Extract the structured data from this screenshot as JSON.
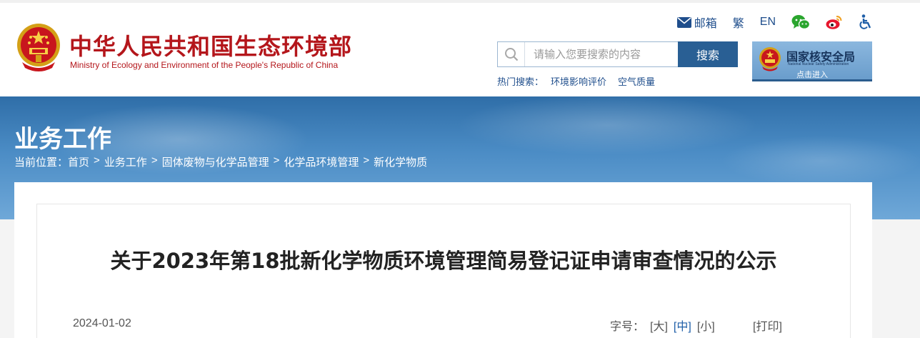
{
  "header": {
    "brand_cn": "中华人民共和国生态环境部",
    "brand_en": "Ministry of Ecology and Environment of the People's Republic of China",
    "emblem_icon": "national-emblem-icon",
    "top_links": {
      "mail": "邮箱",
      "traditional": "繁",
      "english": "EN",
      "wechat_icon": "wechat-icon",
      "weibo_icon": "weibo-icon",
      "accessibility_icon": "accessibility-icon"
    },
    "search": {
      "placeholder": "请输入您要搜索的内容",
      "value": "",
      "button": "搜索"
    },
    "hot_search": {
      "label": "热门搜索：",
      "links": [
        "环境影响评价",
        "空气质量"
      ]
    },
    "nnsa": {
      "title": "国家核安全局",
      "subtitle": "National Nuclear Safety Administration",
      "enter": "点击进入"
    }
  },
  "banner": {
    "section_title": "业务工作",
    "breadcrumb": {
      "label": "当前位置：",
      "separator": ">",
      "items": [
        "首页",
        "业务工作",
        "固体废物与化学品管理",
        "化学品环境管理",
        "新化学物质"
      ]
    }
  },
  "article": {
    "title": "关于2023年第18批新化学物质环境管理简易登记证申请审查情况的公示",
    "date": "2024-01-02",
    "font_size_label": "字号：",
    "font_sizes": [
      "[大]",
      "[中]",
      "[小]"
    ],
    "font_size_selected": "[中]",
    "print": "[打印]"
  },
  "colors": {
    "brand_red": "#b4161b",
    "link_blue": "#1f4e8c",
    "search_button": "#295f94",
    "banner_blue": "#3a7bb8"
  }
}
